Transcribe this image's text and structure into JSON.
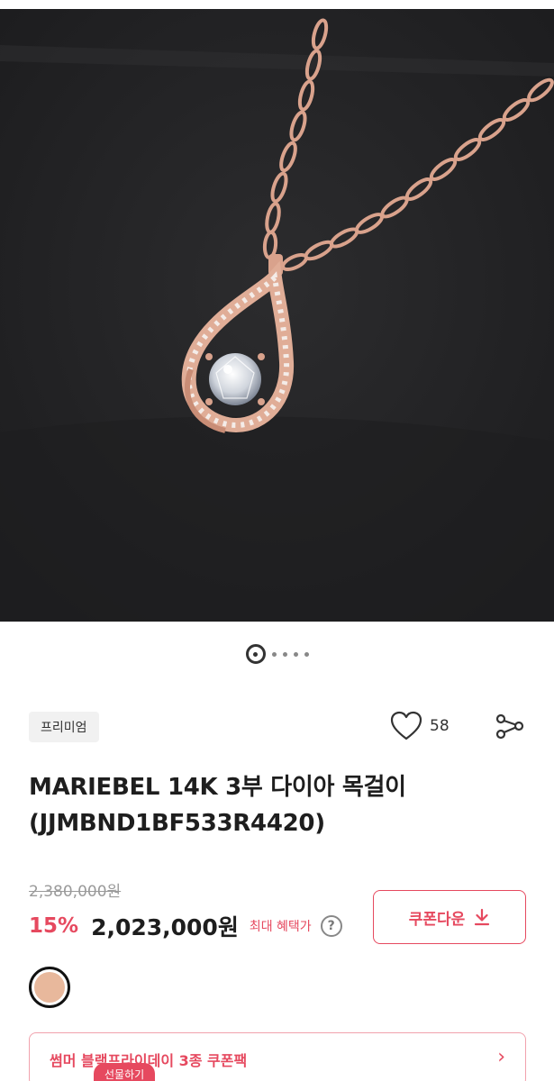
{
  "product": {
    "badge": "프리미엄",
    "like_count": "58",
    "title": "MARIEBEL 14K 3부 다이아 목걸이 (JJMBND1BF533R4420)",
    "original_price": "2,380,000원",
    "discount": "15%",
    "price": "2,023,000원",
    "benefit_label": "최대 혜택가",
    "help_symbol": "?",
    "coupon_button": "쿠폰다운",
    "coupon_icon": "download-icon",
    "swatch_color": "#e8b89c",
    "promo_text": "썸머 블랙프라이데이 3종 쿠폰팩",
    "promo_arrow": "›",
    "gift_label": "선물하기"
  },
  "gallery": {
    "total_images": 5,
    "active_index": 0
  },
  "colors": {
    "accent": "#e6495f",
    "hero_bg": "#232325",
    "rose_gold": "#d9a28c"
  }
}
